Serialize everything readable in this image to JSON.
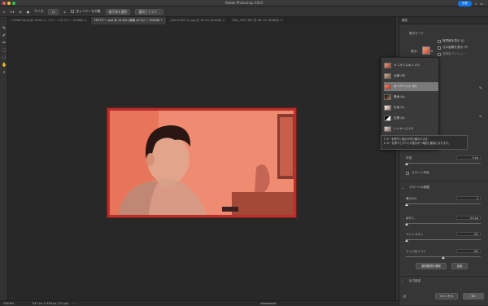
{
  "window": {
    "title": "Adobe Photoshop 2023",
    "share_label": "共有"
  },
  "options_bar": {
    "size_label": "サイズ：",
    "size_value": "15",
    "sample_all_layers": "全レイヤーを対象",
    "auto_enhance": "被写体を選択",
    "select_and_mask": "選択とマスク..."
  },
  "tabs": [
    {
      "label": "COffeeT.png @ 100% (レイヤー 1 のコピー, RGB/8) ×",
      "active": false
    },
    {
      "label": "HPバナー.psd @ 24.6% (背景 のコピー, RGB/8) *",
      "active": true
    },
    {
      "label": "_DSC2164 (1).jpg @ 16.3% (RGB/8) ×",
      "active": false
    },
    {
      "label": "IMG_7937.JPG @ 66.7% (RGB/8) ×",
      "active": false
    }
  ],
  "status": {
    "zoom": "248.6%",
    "doc": "937 px × 509 px (72 ppi)"
  },
  "properties": {
    "header": "属性",
    "view_mode_label": "表示モード",
    "view_label": "表示：",
    "show_edges": "境界線を表示 (J)",
    "show_original": "元の画像を表示 (P)",
    "high_quality_preview": "高精度プレビュー",
    "radius_label": "半径",
    "radius_value": "0 px",
    "smart_radius": "スマート半径",
    "global_refinements": "グローバル調整",
    "smooth_label": "滑らかに",
    "smooth_value": "0",
    "feather_label": "ぼかし",
    "feather_value": "0.0 px",
    "contrast_label": "コントラスト",
    "contrast_value": "0%",
    "shift_edge_label": "エッジをシフト",
    "shift_edge_value": "0%",
    "clear_selection": "選択範囲を解除",
    "invert": "反転",
    "output_settings": "出力設定",
    "cancel": "キャンセル",
    "ok": "OK",
    "partial_value_1": "%",
    "partial_value_2": "%"
  },
  "view_dropdown": {
    "items": [
      {
        "label": "オニオンスキン (O)"
      },
      {
        "label": "点線 (M)"
      },
      {
        "label": "オーバーレイ (V)"
      },
      {
        "label": "黒地 (A)"
      },
      {
        "label": "白地 (T)"
      },
      {
        "label": "白黒 (K)"
      },
      {
        "label": "レイヤー上 (Y)"
      }
    ],
    "highlighted_index": 2,
    "tooltip_line1": "F キーを押すと表示が切り替わります。",
    "tooltip_line2": "X キーを押すとすべての表示が一時的に無効になります。"
  }
}
